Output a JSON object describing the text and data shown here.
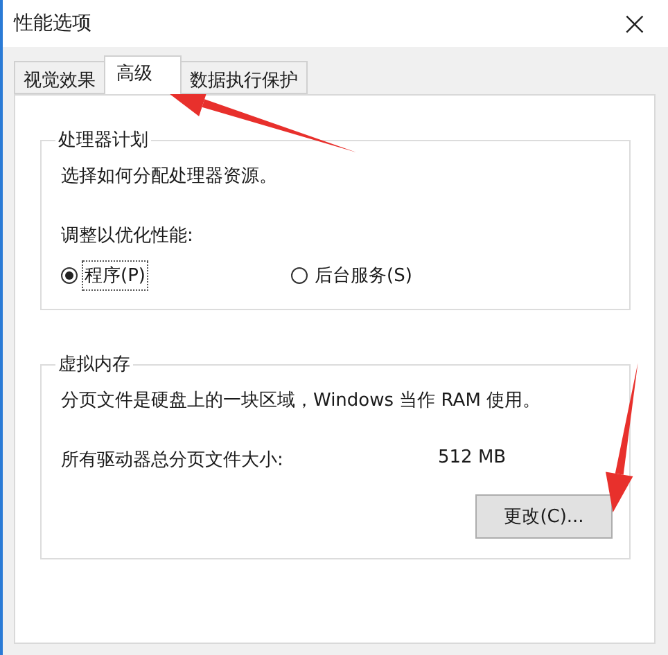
{
  "window": {
    "title": "性能选项",
    "close": "×"
  },
  "tabs": [
    {
      "label": "视觉效果",
      "selected": false
    },
    {
      "label": "高级",
      "selected": true
    },
    {
      "label": "数据执行保护",
      "selected": false
    }
  ],
  "processor": {
    "title": "处理器计划",
    "description": "选择如何分配处理器资源。",
    "adjust_label": "调整以优化性能:",
    "options": [
      {
        "label": "程序(P)",
        "selected": true
      },
      {
        "label": "后台服务(S)",
        "selected": false
      }
    ]
  },
  "virtual_memory": {
    "title": "虚拟内存",
    "description": "分页文件是硬盘上的一块区域，Windows 当作 RAM 使用。",
    "size_label": "所有驱动器总分页文件大小:",
    "size_value": "512 MB",
    "button": "更改(C)..."
  },
  "annotations": [
    {
      "kind": "arrow"
    },
    {
      "kind": "arrow"
    }
  ]
}
